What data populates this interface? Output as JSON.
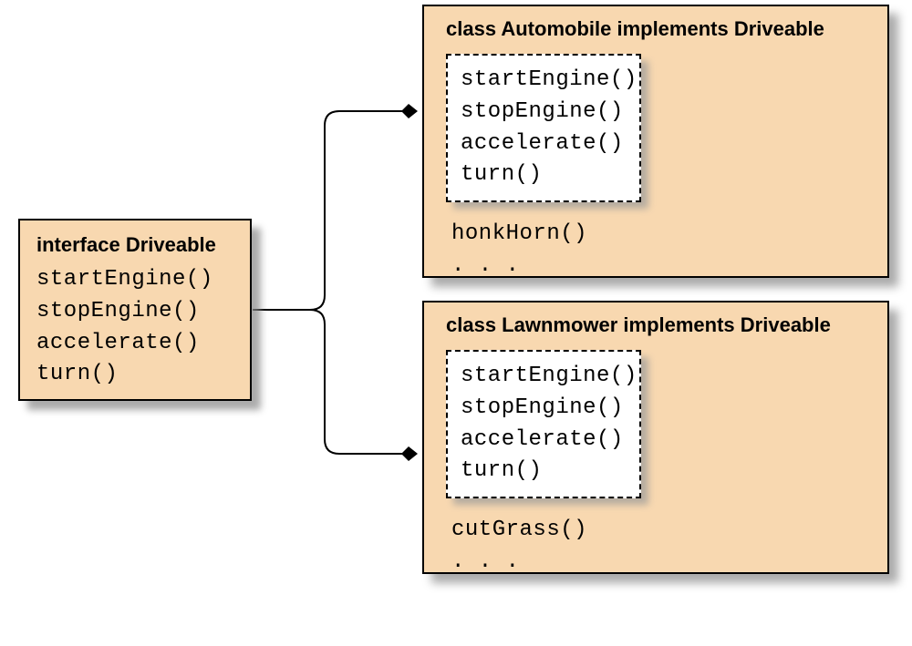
{
  "interface": {
    "title": "interface Driveable",
    "methods": [
      "startEngine()",
      "stopEngine()",
      "accelerate()",
      "turn()"
    ]
  },
  "classes": [
    {
      "title": "class Automobile implements Driveable",
      "implemented": [
        "startEngine()",
        "stopEngine()",
        "accelerate()",
        "turn()"
      ],
      "extra": [
        "honkHorn()",
        ". . ."
      ]
    },
    {
      "title": "class Lawnmower implements Driveable",
      "implemented": [
        "startEngine()",
        "stopEngine()",
        "accelerate()",
        "turn()"
      ],
      "extra": [
        "cutGrass()",
        ". . ."
      ]
    }
  ],
  "chart_data": {
    "type": "diagram",
    "description": "UML-style interface implementation diagram",
    "interface": {
      "name": "Driveable",
      "methods": [
        "startEngine()",
        "stopEngine()",
        "accelerate()",
        "turn()"
      ]
    },
    "implementers": [
      {
        "name": "Automobile",
        "interface_methods": [
          "startEngine()",
          "stopEngine()",
          "accelerate()",
          "turn()"
        ],
        "own_methods": [
          "honkHorn()"
        ]
      },
      {
        "name": "Lawnmower",
        "interface_methods": [
          "startEngine()",
          "stopEngine()",
          "accelerate()",
          "turn()"
        ],
        "own_methods": [
          "cutGrass()"
        ]
      }
    ],
    "edges": [
      {
        "from": "Driveable",
        "to": "Automobile"
      },
      {
        "from": "Driveable",
        "to": "Lawnmower"
      }
    ]
  }
}
